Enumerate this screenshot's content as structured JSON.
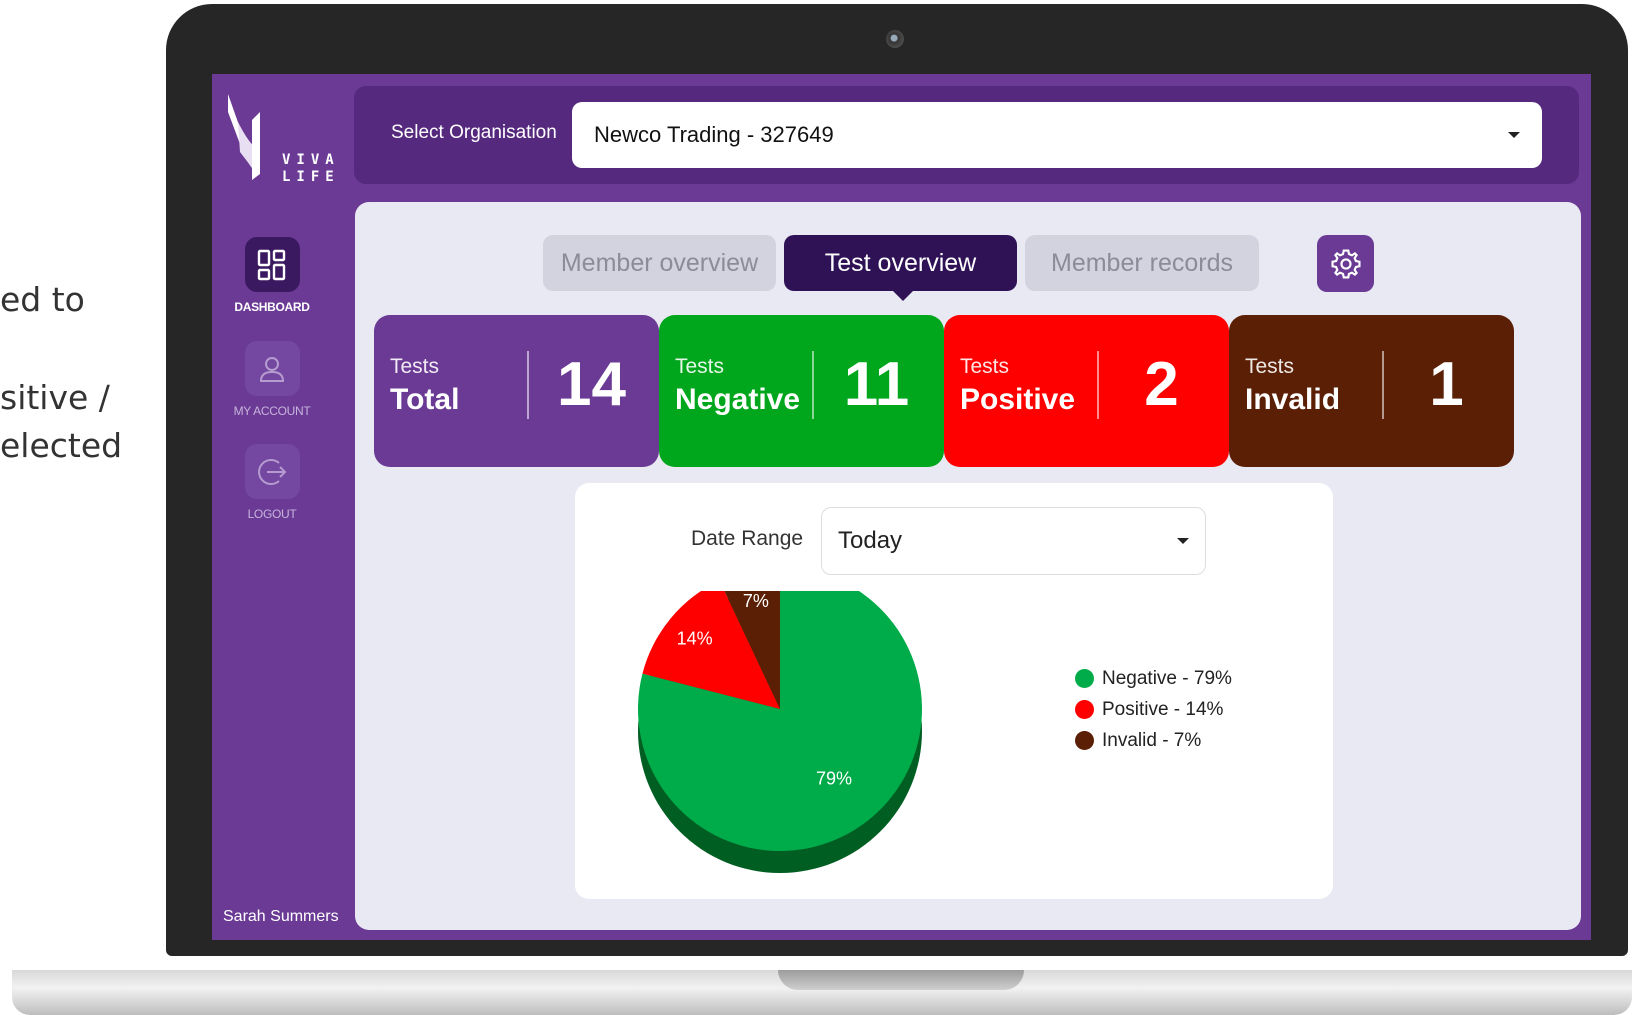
{
  "side_text": [
    "ed to",
    "sitive /",
    "elected"
  ],
  "brand": {
    "logo_text": "VIVA LIFE"
  },
  "sidebar": {
    "items": [
      {
        "label": "DASHBOARD",
        "icon": "dashboard-icon",
        "active": true
      },
      {
        "label": "MY ACCOUNT",
        "icon": "user-icon",
        "active": false
      },
      {
        "label": "LOGOUT",
        "icon": "logout-icon",
        "active": false
      }
    ],
    "user_name": "Sarah Summers"
  },
  "organisation": {
    "label": "Select Organisation",
    "value": "Newco Trading - 327649"
  },
  "tabs": [
    {
      "label": "Member overview",
      "active": false
    },
    {
      "label": "Test overview",
      "active": true
    },
    {
      "label": "Member records",
      "active": false
    }
  ],
  "stats": [
    {
      "small": "Tests",
      "big": "Total",
      "value": "14",
      "color": "#6a3a95"
    },
    {
      "small": "Tests",
      "big": "Negative",
      "value": "11",
      "color": "#00a61b"
    },
    {
      "small": "Tests",
      "big": "Positive",
      "value": "2",
      "color": "#ff0000"
    },
    {
      "small": "Tests",
      "big": "Invalid",
      "value": "1",
      "color": "#5a1f05"
    }
  ],
  "date_range": {
    "label": "Date Range",
    "value": "Today"
  },
  "chart_data": {
    "type": "pie",
    "categories": [
      "Negative",
      "Positive",
      "Invalid"
    ],
    "values": [
      79,
      14,
      7
    ],
    "slice_labels": [
      "79%",
      "14%",
      "7%"
    ],
    "colors": [
      "#00ac4a",
      "#ff0000",
      "#5a1f05"
    ],
    "legend": [
      "Negative - 79%",
      "Positive  - 14%",
      "Invalid - 7%"
    ],
    "legend_position": "right"
  },
  "colors": {
    "accent": "#6a3a95",
    "dark_accent": "#2f1256"
  }
}
